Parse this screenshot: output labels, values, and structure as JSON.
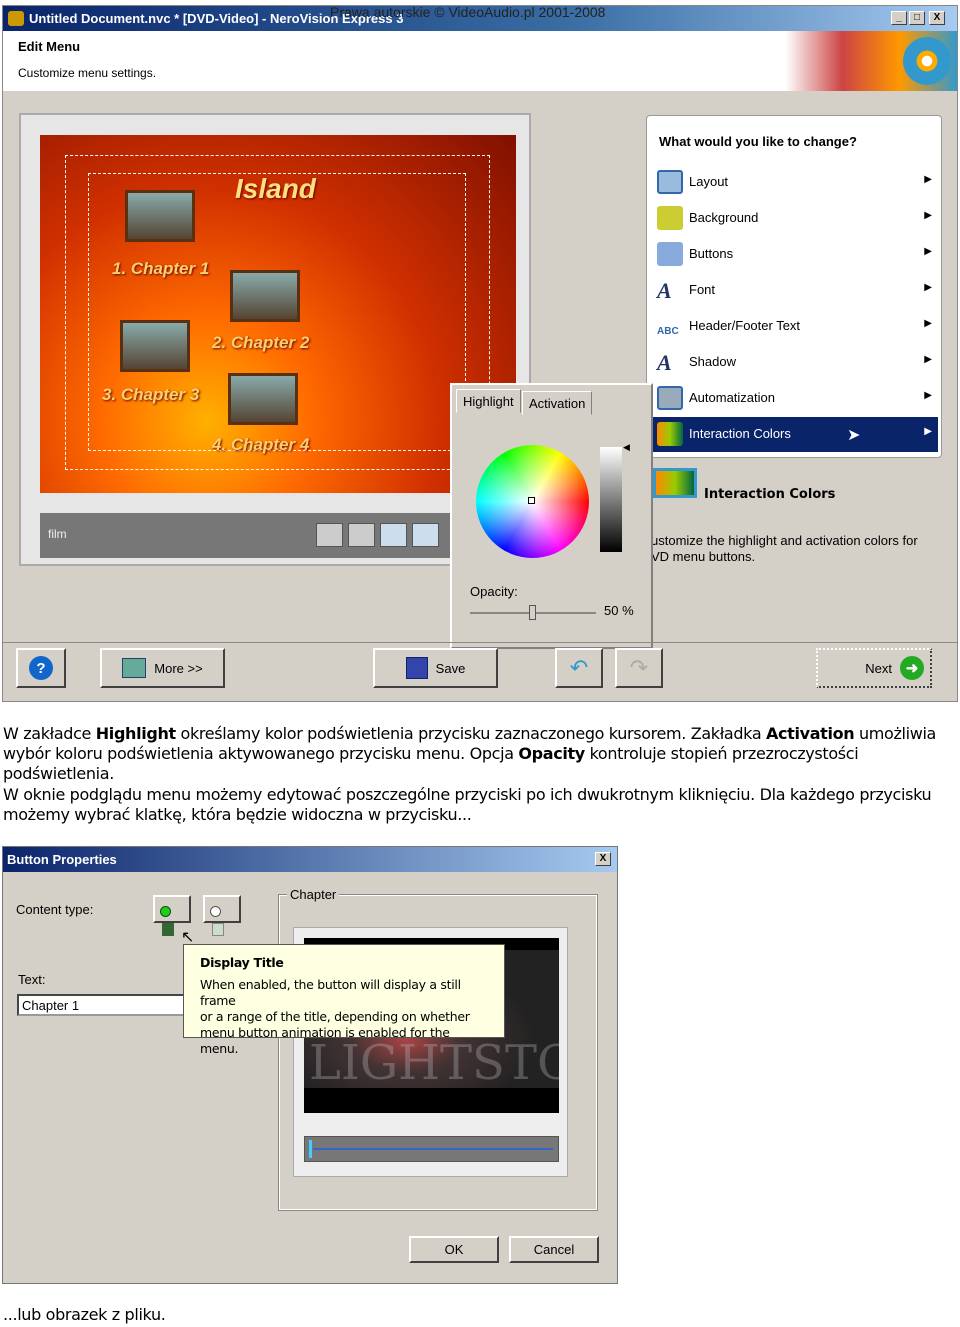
{
  "watermark": "Prawa autorskie © VideoAudio.pl 2001-2008",
  "window": {
    "title": "Untitled Document.nvc * [DVD-Video] - NeroVision Express 3",
    "header_title": "Edit Menu",
    "header_subtitle": "Customize menu settings."
  },
  "preview": {
    "menu_title": "Island",
    "chapters": [
      "1. Chapter 1",
      "2. Chapter 2",
      "3. Chapter 3",
      "4. Chapter 4"
    ],
    "control_label": "film"
  },
  "menu": {
    "question": "What would you like to change?",
    "items": [
      {
        "label": "Layout",
        "icon": "layout-icon"
      },
      {
        "label": "Background",
        "icon": "background-icon"
      },
      {
        "label": "Buttons",
        "icon": "buttons-icon"
      },
      {
        "label": "Font",
        "icon": "font-icon"
      },
      {
        "label": "Header/Footer Text",
        "icon": "header-footer-icon"
      },
      {
        "label": "Shadow",
        "icon": "shadow-icon"
      },
      {
        "label": "Automatization",
        "icon": "automatization-icon"
      },
      {
        "label": "Interaction Colors",
        "icon": "interaction-colors-icon",
        "selected": true
      }
    ]
  },
  "color_popup": {
    "tabs": [
      "Highlight",
      "Activation"
    ],
    "active_tab": "Highlight",
    "opacity_label": "Opacity:",
    "opacity_value": "50 %",
    "opacity_percent": 50
  },
  "description": {
    "title": "Interaction Colors",
    "text1": "ustomize the highlight and activation colors for",
    "text2": "VD menu buttons."
  },
  "toolbar": {
    "help": "?",
    "more": "More >>",
    "save": "Save",
    "next": "Next"
  },
  "paragraphs": {
    "p1": [
      {
        "t": "W zakładce "
      },
      {
        "t": "Highlight",
        "b": true
      },
      {
        "t": " określamy kolor podświetlenia przycisku zaznaczonego kursorem. Zakładka  "
      },
      {
        "t": "Activation",
        "b": true
      },
      {
        "t": " umożliwia wybór koloru podświetlenia aktywowanego przycisku menu. Opcja  "
      },
      {
        "t": "Opacity",
        "b": true
      },
      {
        "t": " kontroluje stopień przezroczystości podświetlenia."
      }
    ],
    "p2": "W oknie podglądu menu możemy edytować poszczególne przyciski po ich dwukrotnym kliknięciu. Dla każdego przycisku możemy wybrać klatkę, która będzie widoczna w przycisku...",
    "p3": "...lub obrazek z pliku."
  },
  "dialog": {
    "title": "Button Properties",
    "close": "X",
    "content_type_label": "Content type:",
    "text_label": "Text:",
    "text_value": "Chapter 1",
    "group_label": "Chapter",
    "preview_text": "LIGHTSTO",
    "tooltip_title": "Display Title",
    "tooltip_lines": [
      "When enabled, the button will display a still frame",
      "or a range of the title, depending on whether",
      "menu button animation is enabled for the menu."
    ],
    "ok": "OK",
    "cancel": "Cancel"
  },
  "colors": {
    "titlebar": "#0a246a",
    "selection": "#0a246a",
    "tooltip": "#ffffe1",
    "chapter_text": "#ffd070"
  }
}
